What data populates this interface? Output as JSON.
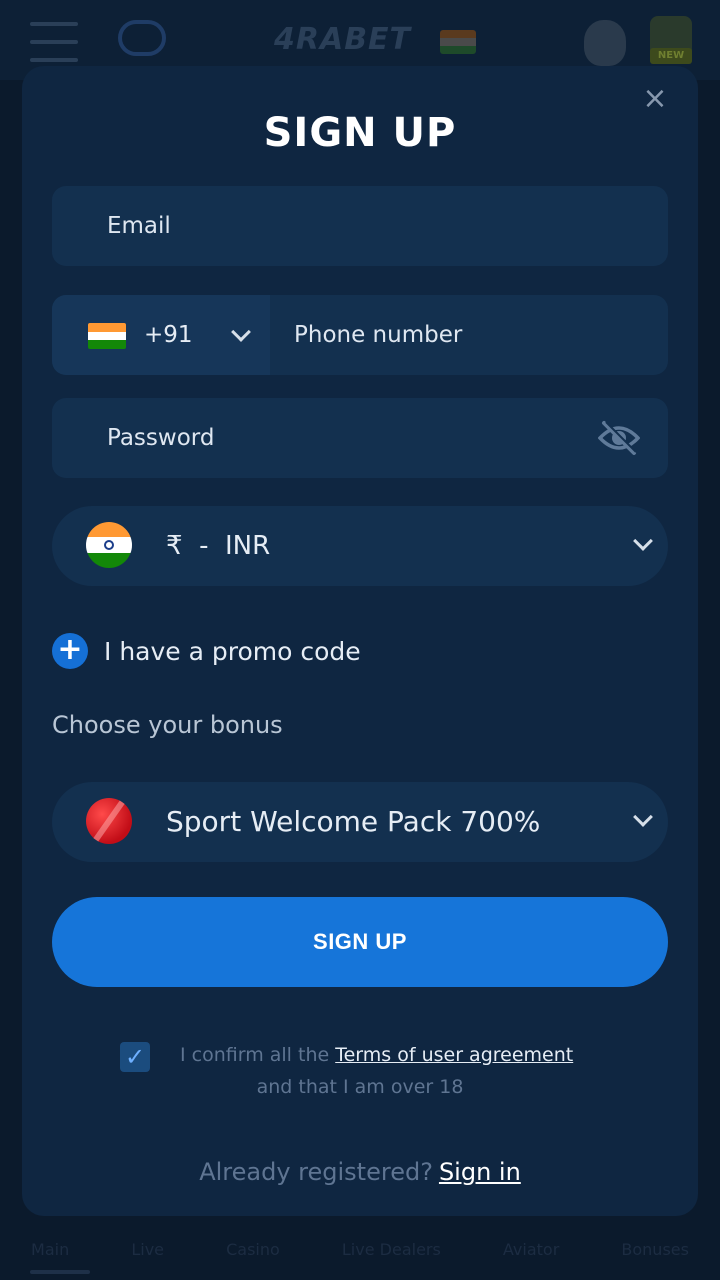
{
  "background": {
    "logo": "4RABET",
    "new_badge": "NEW",
    "nav": [
      "Main",
      "Live",
      "Casino",
      "Live Dealers",
      "Aviator",
      "Bonuses"
    ]
  },
  "modal": {
    "title": "SIGN UP",
    "close_label": "×",
    "email_placeholder": "Email",
    "phone": {
      "country_code": "+91",
      "placeholder": "Phone number"
    },
    "password_placeholder": "Password",
    "currency": {
      "symbol": "₹",
      "separator": "-",
      "code": "INR"
    },
    "promo_label": "I have a promo code",
    "bonus_heading": "Choose your bonus",
    "bonus_selected": "Sport Welcome Pack 700%",
    "submit_label": "SIGN UP",
    "agreement": {
      "checked": true,
      "check_mark": "✓",
      "prefix": "I confirm all the",
      "link_text": "Terms of user agreement",
      "suffix": "and that I am over 18"
    },
    "signin": {
      "prompt": "Already registered?",
      "link_text": "Sign in"
    }
  },
  "colors": {
    "modal_bg": "#0f2641",
    "field_bg": "#13304f",
    "accent": "#1675d9",
    "text_primary": "#e6edf5",
    "text_muted": "#5f7592"
  },
  "icons": [
    "close-icon",
    "india-flag-icon",
    "chevron-down-icon",
    "eye-off-icon",
    "plus-icon",
    "cricket-ball-icon",
    "checkbox-check-icon"
  ]
}
